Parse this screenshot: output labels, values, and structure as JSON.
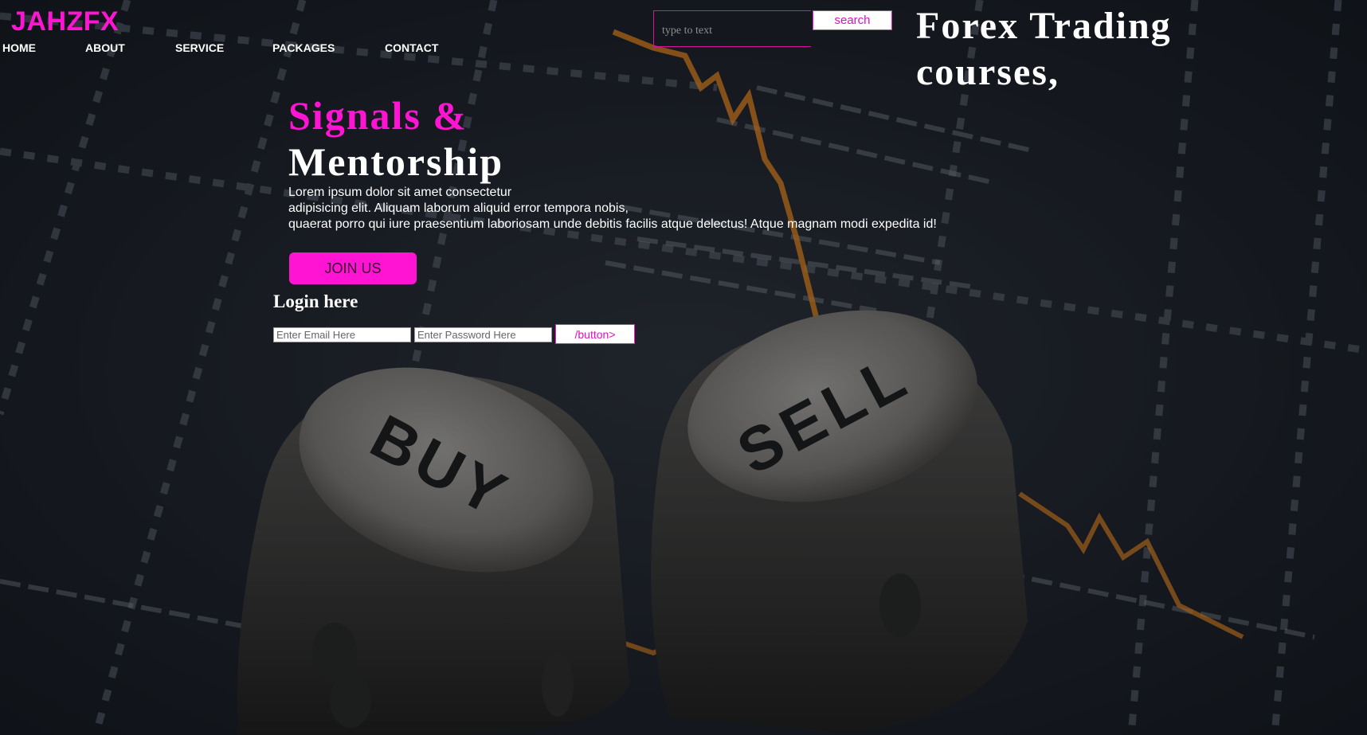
{
  "brand": {
    "logo_text": "JAHZFX"
  },
  "nav": {
    "items": [
      "HOME",
      "ABOUT",
      "SERVICE",
      "PACKAGES",
      "CONTACT"
    ]
  },
  "search": {
    "placeholder": "type to text",
    "button_label": "search"
  },
  "top_heading": "Forex Trading courses,",
  "hero": {
    "title_line1": "Signals &",
    "title_line2": "Mentorship",
    "text_lines": [
      "Lorem ipsum dolor sit amet consectetur",
      "adipisicing elit. Aliquam laborum aliquid error tempora nobis,",
      "quaerat porro qui iure praesentium laboriosam unde debitis facilis atque delectus! Atque magnam modi expedita id!"
    ],
    "join_label": "JOIN US"
  },
  "login": {
    "title": "Login here",
    "email_placeholder": "Enter Email Here",
    "password_placeholder": "Enter Password Here",
    "button_label": "/button>"
  },
  "background": {
    "dice_left_text": "BUY",
    "dice_right_text": "SELL"
  },
  "colors": {
    "accent": "#ff14d4",
    "background": "#1a1d24",
    "chart_orange": "#f08a1c"
  }
}
